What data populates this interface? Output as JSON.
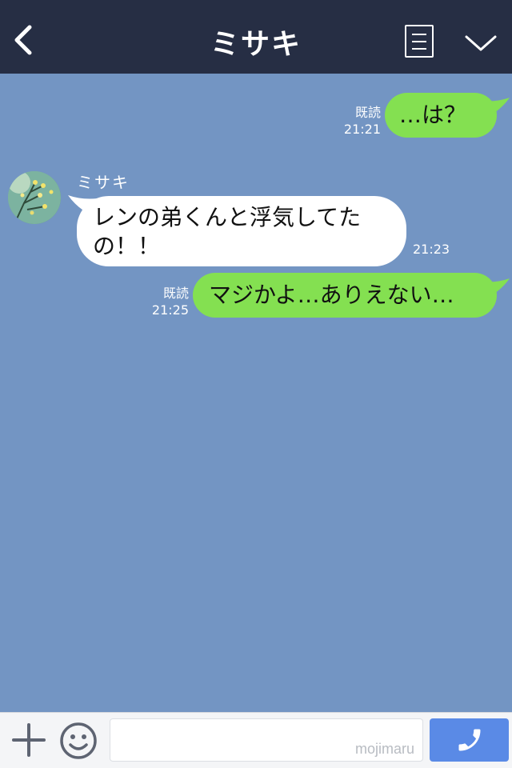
{
  "header": {
    "title": "ミサキ",
    "back_icon": "chevron-left-icon",
    "menu_icon": "notes-icon",
    "collapse_icon": "chevron-down-icon"
  },
  "messages": [
    {
      "direction": "out",
      "text": "…は？",
      "read_label": "既読",
      "time": "21:21"
    },
    {
      "direction": "in",
      "sender": "ミサキ",
      "lines": [
        "レンの弟くんと浮気してた",
        "の！！"
      ],
      "time": "21:23"
    },
    {
      "direction": "out",
      "text": "マジかよ…ありえない…",
      "read_label": "既読",
      "time": "21:25"
    }
  ],
  "input_bar": {
    "plus_icon": "plus-icon",
    "emoji_icon": "smiley-icon",
    "placeholder": "",
    "watermark": "mojimaru",
    "call_icon": "phone-icon"
  },
  "colors": {
    "header_bg": "#262e44",
    "chat_bg": "#7395c3",
    "outgoing_bubble": "#84e051",
    "incoming_bubble": "#ffffff",
    "call_button": "#5a8ae6"
  }
}
